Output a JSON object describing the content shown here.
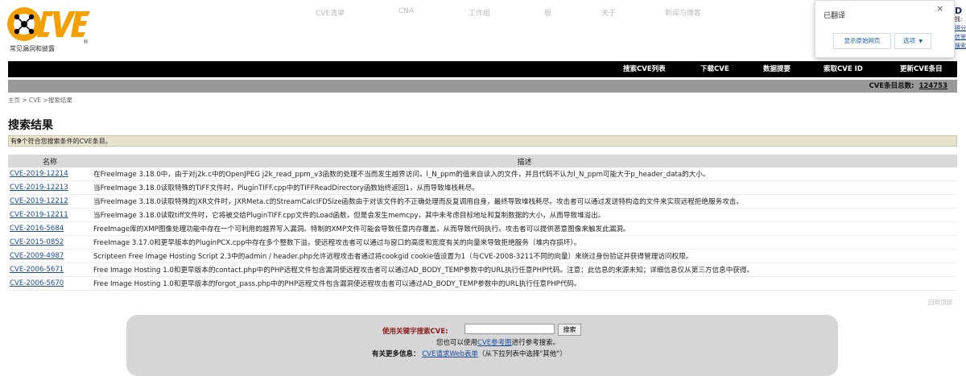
{
  "logo": {
    "text": "CVE",
    "subtitle": "常见漏洞和披露",
    "registered": "®"
  },
  "top_nav": [
    "CVE清单",
    "CNA",
    "工作组",
    "板",
    "关于",
    "新闻与博客"
  ],
  "translate_popup": {
    "title": "已翻译",
    "show_original": "显示原始网页",
    "options": "选项",
    "close": "×"
  },
  "edge_fragments": [
    "D",
    "找:",
    "得分",
    "信誉",
    "搜索"
  ],
  "menu_bar": [
    "搜索CVE列表",
    "下载CVE",
    "数据提要",
    "索取CVE ID",
    "更新CVE条目"
  ],
  "count_label": "CVE条目总数:",
  "count_value": "124753",
  "breadcrumb": "主页 > CVE >搜索结果",
  "page_title": "搜索结果",
  "result_note": {
    "prefix": "有",
    "count": "9",
    "suffix": "个符合您搜索条件的CVE条目。"
  },
  "table": {
    "headers": [
      "名称",
      "描述"
    ],
    "rows": [
      {
        "id": "CVE-2019-12214",
        "desc": "在FreeImage 3.18.0中，由于对j2k.c中的OpenJPEG j2k_read_ppm_v3函数的处理不当而发生越界访问。l_N_ppm的值来自读入的文件，并且代码不认为l_N_ppm可能大于p_header_data的大小。"
      },
      {
        "id": "CVE-2019-12213",
        "desc": "当FreeImage 3.18.0读取特殊的TIFF文件时，PluginTIFF.cpp中的TIFFReadDirectory函数始终返回1，从而导致堆栈耗尽。"
      },
      {
        "id": "CVE-2019-12212",
        "desc": "当FreeImage 3.18.0读取特殊的JXR文件时，JXRMeta.c的StreamCalcIFDSize函数由于对该文件的不正确处理而反复调用自身，最终导致堆栈耗尽。攻击者可以通过发送特构造的文件来实现远程拒绝服务攻击。"
      },
      {
        "id": "CVE-2019-12211",
        "desc": "当FreeImage 3.18.0读取tiff文件时，它将被交给PluginTIFF.cpp文件的Load函数，但是会发生memcpy，其中未考虑目标地址和复制数据的大小，从而导致堆溢出。"
      },
      {
        "id": "CVE-2016-5684",
        "desc": "FreeImage库的XMP图像处理功能中存在一个可利用的越界写入漏洞。特制的XMP文件可能会导致任意内存覆盖，从而导致代码执行。攻击者可以提供恶意图像来触发此漏洞。"
      },
      {
        "id": "CVE-2015-0852",
        "desc": "FreeImage 3.17.0和更早版本的PluginPCX.cpp中存在多个整数下溢，使远程攻击者可以通过与窗口的高度和宽度有关的向量来导致拒绝服务（堆内存损坏）。"
      },
      {
        "id": "CVE-2009-4987",
        "desc": "Scripteen Free Image Hosting Script 2.3中的admin / header.php允许远程攻击者通过将cookgid cookie值设置为1（与CVE-2008-3211不同的向量）来绕过身份验证并获得管理访问权限。"
      },
      {
        "id": "CVE-2006-5671",
        "desc": "Free Image Hosting 1.0和更早版本的contact.php中的PHP远程文件包含漏洞使远程攻击者可以通过AD_BODY_TEMP参数中的URL执行任意PHP代码。注意：此信息的来源未知；详细信息仅从第三方信息中获得。"
      },
      {
        "id": "CVE-2006-5670",
        "desc": "Free Image Hosting 1.0和更早版本的forgot_pass.php中的PHP远程文件包含漏洞使远程攻击者可以通过AD_BODY_TEMP参数中的URL执行任意PHP代码。"
      }
    ]
  },
  "back_to_top": "回到顶部",
  "search_panel": {
    "label": "使用关键字搜索CVE:",
    "input_value": "",
    "button": "搜索",
    "line2_prefix": "您也可以使用",
    "line2_link": "CVE参考图",
    "line2_suffix": "进行参考搜索。",
    "line3_label": "有关更多信息：",
    "line3_link": "CVE请求Web表单",
    "line3_suffix": "（从下拉列表中选择\"其他\"）"
  },
  "colors": {
    "menu_bg": "#000000",
    "count_bar": "#999999",
    "note_bg": "#e6e4cf",
    "link": "#1a4ca0",
    "logo_orange": "#f5a000",
    "search_label": "#8b1a1a"
  }
}
